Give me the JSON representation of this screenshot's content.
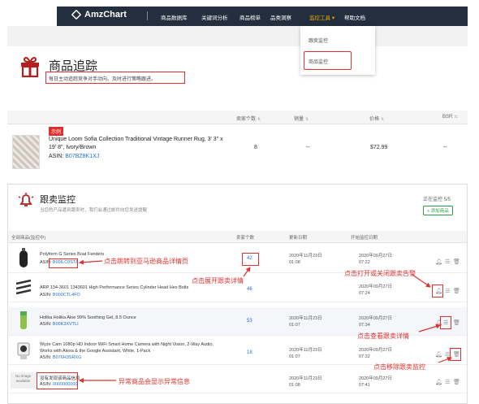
{
  "nav": {
    "logo": "AmzChart",
    "items": [
      "商品数据库",
      "关键词分析",
      "商品榜单",
      "品类洞察",
      "监控工具",
      "帮助文档"
    ],
    "active_index": 4,
    "dropdown_arrow": "▾"
  },
  "dropdown": {
    "items": [
      "跟卖监控",
      "商品监控"
    ],
    "highlighted_index": 1
  },
  "header": {
    "title": "商品追踪",
    "subtitle": "每日主动追踪竞争对手动向、及时进行策略跟进。"
  },
  "product_table": {
    "columns": [
      "卖家个数",
      "销量",
      "价格",
      "BSR"
    ],
    "sort_icon": "⇅",
    "badge": "示例",
    "row": {
      "name": "Unique Loom Sofia Collection Traditional Vintage Runner Rug, 3' 3\" x 19' 8\", Ivory/Brown",
      "asin_label": "ASIN:",
      "asin": "B07BZ8K1XJ",
      "sellers": "8",
      "sales": "--",
      "price": "$72.99",
      "bsr": "--"
    }
  },
  "monitor": {
    "title": "跟卖监控",
    "subtitle": "当您的产品遭到跟卖时，我们会通过邮件向您发送提醒",
    "count": "正在监控 5/5",
    "add_button": "+ 添加商品",
    "columns": [
      "全部商品(监控中)",
      "卖家个数",
      "更新日期",
      "开始监控日期"
    ],
    "rows": [
      {
        "name": "Polyform G Series Boat Fenders",
        "asin_label": "ASIN:",
        "asin": "B00ILC0STA",
        "sellers": "42",
        "updated": [
          "2020年11月23日",
          "01:08"
        ],
        "started": [
          "2020年09月27日",
          "07:22"
        ]
      },
      {
        "name": "ARP 134-3601 1343601 High Performance Series Cylinder Head Hex Bolts",
        "asin_label": "ASIN:",
        "asin": "B000CTL4FO",
        "sellers": "46",
        "updated": [
          "2020年11月23日",
          "01:07"
        ],
        "started": [
          "2020年09月27日",
          "07:24"
        ]
      },
      {
        "name": "Holika Holika Aloe 99% Soothing Gel, 8.5 Ounce",
        "asin_label": "ASIN:",
        "asin": "B00K3XVTLI",
        "sellers": "53",
        "updated": [
          "2020年11月23日",
          "01:07"
        ],
        "started": [
          "2020年09月27日",
          "07:34"
        ]
      },
      {
        "name": "Wyze Cam 1080p HD Indoor WiFi Smart Home Camera with Night Vision, 2-Way Audio,",
        "name2": "Works with Alexa & the Google Assistant, White, 1-Pack",
        "asin_label": "ASIN:",
        "asin": "B076H3SRXG",
        "sellers": "18",
        "updated": [
          "2020年11月23日",
          "01:07"
        ],
        "started": [
          "2020年09月27日",
          "07:32"
        ]
      },
      {
        "name": "没有发现该商品信息",
        "asin_label": "ASIN:",
        "asin": "0000000000",
        "sellers": "",
        "updated": [
          "2020年11月23日",
          "01:08"
        ],
        "started": [
          "2020年09月27日",
          "07:41"
        ],
        "no_image_text": "No image available"
      }
    ],
    "action_icons": [
      "bell-icon",
      "list-icon",
      "trash-icon"
    ]
  },
  "annotations": {
    "asin_link": "点击跳转到亚马逊商品详情页",
    "expand": "点击展开跟卖详情",
    "toggle": "点击打开或关闭跟卖告警",
    "detail": "点击查看跟卖详情",
    "remove": "点击移除跟卖监控",
    "abnormal": "异常商品会显示异常信息"
  },
  "colors": {
    "nav_bg": "#232f3e",
    "accent": "#e0302e",
    "link": "#1f6fd1",
    "active_nav": "#f0a500",
    "add_green": "#2a9d4a"
  }
}
